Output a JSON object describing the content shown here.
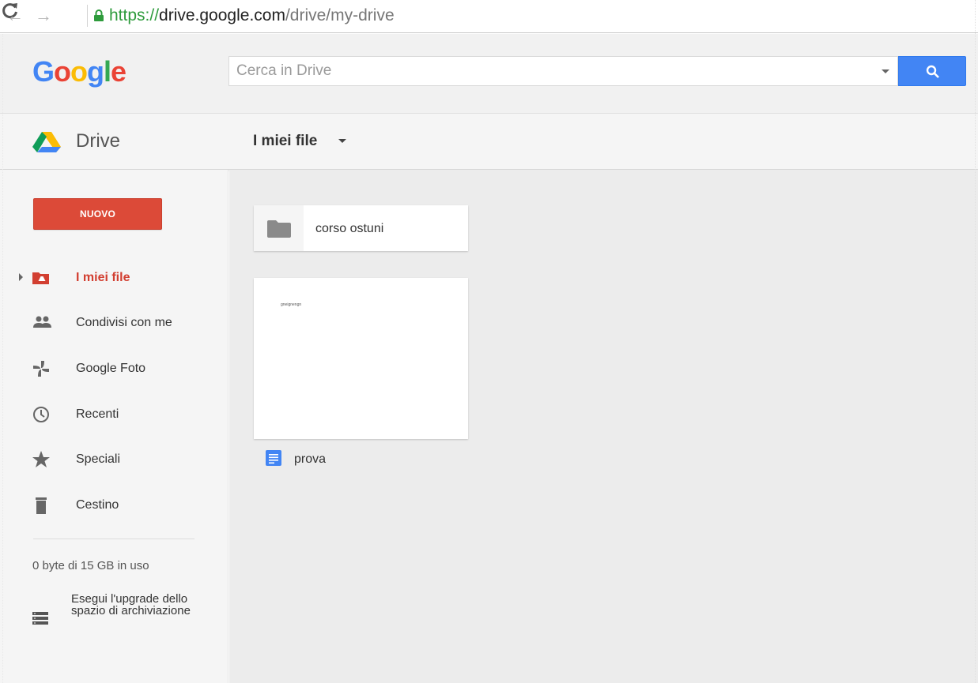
{
  "browser": {
    "back_icon": "arrow-left-icon",
    "forward_icon": "arrow-right-icon",
    "reload_icon": "reload-icon",
    "lock_icon": "lock-icon",
    "url_scheme": "https://",
    "url_host": "drive.google.com",
    "url_path": "/drive/my-drive"
  },
  "header": {
    "logo_letters": [
      "G",
      "o",
      "o",
      "g",
      "l",
      "e"
    ],
    "logo_colors": [
      "#4285f4",
      "#ea4335",
      "#fbbc05",
      "#4285f4",
      "#34a853",
      "#ea4335"
    ],
    "search_placeholder": "Cerca in Drive",
    "search_value": "",
    "search_button_color": "#4285f4"
  },
  "appbar": {
    "app_name": "Drive",
    "location_label": "I miei file"
  },
  "sidebar": {
    "new_button_label": "NUOVO",
    "new_button_color": "#dc4a38",
    "items": [
      {
        "label": "I miei file",
        "icon": "my-drive-folder-icon",
        "active": true
      },
      {
        "label": "Condivisi con me",
        "icon": "people-icon",
        "active": false
      },
      {
        "label": "Google Foto",
        "icon": "photos-pinwheel-icon",
        "active": false
      },
      {
        "label": "Recenti",
        "icon": "clock-icon",
        "active": false
      },
      {
        "label": "Speciali",
        "icon": "star-icon",
        "active": false
      },
      {
        "label": "Cestino",
        "icon": "trash-icon",
        "active": false
      }
    ],
    "storage_text": "0 byte di 15 GB in uso",
    "upgrade_label": "Esegui l'upgrade dello spazio di archiviazione",
    "upgrade_icon": "storage-list-icon"
  },
  "main": {
    "folders": [
      {
        "name": "corso ostuni",
        "icon": "folder-icon"
      }
    ],
    "files": [
      {
        "name": "prova",
        "icon": "docs-icon",
        "preview_text": "gneignengn"
      }
    ]
  }
}
